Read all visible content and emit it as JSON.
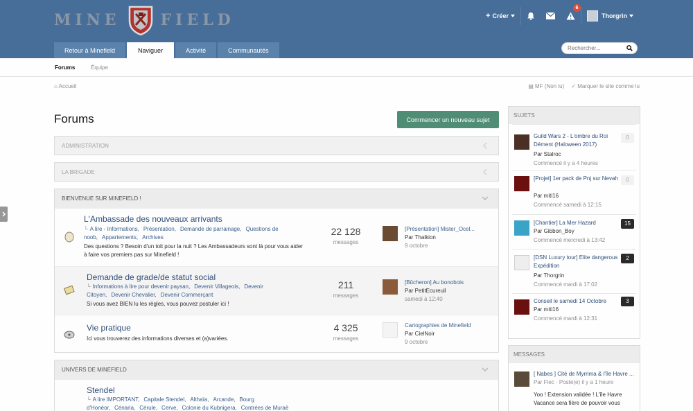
{
  "header": {
    "logo_left": "MINE",
    "logo_right": "FIELD",
    "create_label": "Créer",
    "alerts_count": "6",
    "username": "Thorgrin",
    "search_placeholder": "Rechercher..."
  },
  "tabs": [
    "Retour à Minefield",
    "Naviguer",
    "Activité",
    "Communautés"
  ],
  "subnav": [
    "Forums",
    "Équipe"
  ],
  "breadcrumb": "Accueil",
  "crumb_actions": [
    "MF (Non lu)",
    "Marquer le site comme lu"
  ],
  "page_title": "Forums",
  "new_topic_label": "Commencer un nouveau sujet",
  "categories": {
    "admin": "ADMINISTRATION",
    "brigade": "LA BRIGADE",
    "welcome": "BIENVENUE SUR MINEFIELD !",
    "univers": "UNIVERS DE MINEFIELD"
  },
  "forums": [
    {
      "title": "L'Ambassade des nouveaux arrivants",
      "subs": [
        "A lire - Informations",
        "Présentation",
        "Demande de parrainage",
        "Questions de noob",
        "Appartements",
        "Archives"
      ],
      "desc": "Des questions ? Besoin d'un toit pour la nuit ? Les Ambassadeurs sont là pour vous aider à faire vos premiers pas sur Minefield !",
      "count": "22 128",
      "count_label": "messages",
      "last_title": "[Présentation] Mister_Ocel...",
      "last_user": "Par Thalkion",
      "last_date": "9 octobre"
    },
    {
      "title": "Demande de grade/de statut social",
      "subs": [
        "Informations à lire pour devenir paysan",
        "Devenir Villageois",
        "Devenir Citoyen",
        "Devenir Chevalier",
        "Devenir Commerçant"
      ],
      "desc": "Si vous avez BIEN lu les règles, vous pouvez postuler ici !",
      "count": "211",
      "count_label": "messages",
      "last_title": "[Bûcheron] Au bonobois",
      "last_user": "Par PetitEcureuil",
      "last_date": "samedi à 12:40"
    },
    {
      "title": "Vie pratique",
      "subs": [],
      "desc": "Ici vous trouverez des informations diverses et (a)variées.",
      "count": "4 325",
      "count_label": "messages",
      "last_title": "Cartographies de Minefield",
      "last_user": "Par CielNoir",
      "last_date": "9 octobre"
    },
    {
      "title": "Stendel",
      "subs": [
        "A lire IMPORTANT",
        "Capitale Stendel",
        "Althaïa",
        "Arcande",
        "Bourg d'Honéor",
        "Cénaria",
        "Cérule",
        "Cerve",
        "Colonie du Kubnigera",
        "Contrées de Muraë"
      ],
      "desc": "",
      "count": "",
      "count_label": "",
      "last_title": "",
      "last_user": "",
      "last_date": ""
    }
  ],
  "sidebar": {
    "topics_head": "SUJETS",
    "topics": [
      {
        "title": "Guild Wars 2 - L'ombre du Roi Dément (Haloween 2017)",
        "user": "Par Stalroc",
        "date": "Commencé il y a 4 heures",
        "count": "0"
      },
      {
        "title": "[Projet] 1er pack de Pnj sur Nevah",
        "user": "Par miti16",
        "date": "Commencé samedi à 12:15",
        "count": "0"
      },
      {
        "title": "[Chantier] La Mer Hazard",
        "user": "Par Gibbon_Boy",
        "date": "Commencé mercredi à 13:42",
        "count": "15"
      },
      {
        "title": "[DSN Luxury tour] Elite dangerous Expédition",
        "user": "Par Thorgrin",
        "date": "Commencé mardi à 17:02",
        "count": "2"
      },
      {
        "title": "Conseil le samedi 14 Octobre",
        "user": "Par miti16",
        "date": "Commencé mardi à 12:31",
        "count": "3"
      }
    ],
    "messages_head": "MESSAGES",
    "message": {
      "title": "[ Nabes ] Cité de Myrrima & l'île Havre ...",
      "meta": "Par Flec · Posté(e) il y a 1 heure",
      "body": "Yoo !   Extension validée ! L'île Havre Vacance sera fière de pouvoir vous"
    }
  }
}
